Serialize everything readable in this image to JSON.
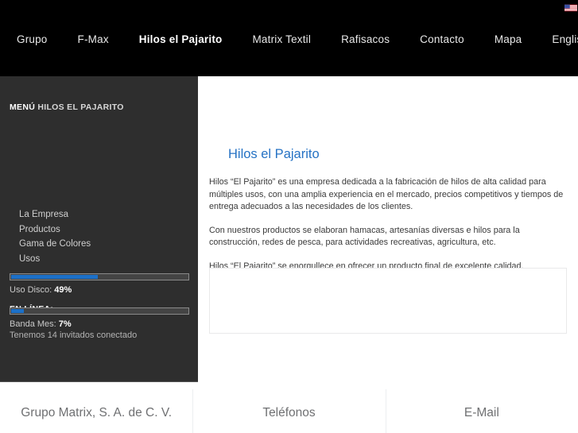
{
  "topbar": {
    "flag_icon": "us-flag-icon",
    "nav": [
      {
        "label": "Grupo",
        "active": false
      },
      {
        "label": "F-Max",
        "active": false
      },
      {
        "label": "Hilos el Pajarito",
        "active": true
      },
      {
        "label": "Matrix Textil",
        "active": false
      },
      {
        "label": "Rafisacos",
        "active": false
      },
      {
        "label": "Contacto",
        "active": false
      },
      {
        "label": "Mapa",
        "active": false
      },
      {
        "label": "English",
        "active": false
      }
    ]
  },
  "sidebar": {
    "heading_strong": "MENÚ",
    "heading_light": "HILOS EL PAJARITO",
    "items": [
      {
        "label": "La Empresa"
      },
      {
        "label": "Productos"
      },
      {
        "label": "Gama de Colores"
      },
      {
        "label": "Usos"
      }
    ],
    "online_heading": "EN LÍNEA:",
    "online_text": "Tenemos 14 invitados conectado",
    "meters": [
      {
        "label_text": "Uso Disco: ",
        "value_text": "49%",
        "percent": 49
      },
      {
        "label_text": "Banda Mes: ",
        "value_text": "7%",
        "percent": 7
      }
    ],
    "accent_color": "#1c70c8",
    "background_color": "#2e2e2e"
  },
  "main": {
    "title": "Hilos el Pajarito",
    "title_color": "#2572c4",
    "paragraphs": [
      "Hilos “El Pajarito” es una empresa dedicada a la fabricación de hilos de alta calidad para múltiples usos, con una amplia experiencia en el mercado, precios competitivos y tiempos de entrega adecuados a las necesidades de los clientes.",
      "Con nuestros productos se elaboran hamacas, artesanías diversas e hilos para la construcción, redes de pesca, para actividades recreativas, agricultura, etc.",
      "Hilos “El Pajarito” se enorgullece en ofrecer un producto final de excelente calidad."
    ],
    "media_placeholder": ""
  },
  "footer": {
    "columns": [
      {
        "title": "Grupo Matrix, S. A. de C. V.",
        "subtitle": ""
      },
      {
        "title": "Teléfonos",
        "subtitle": ""
      },
      {
        "title": "E-Mail",
        "subtitle": ""
      }
    ]
  }
}
